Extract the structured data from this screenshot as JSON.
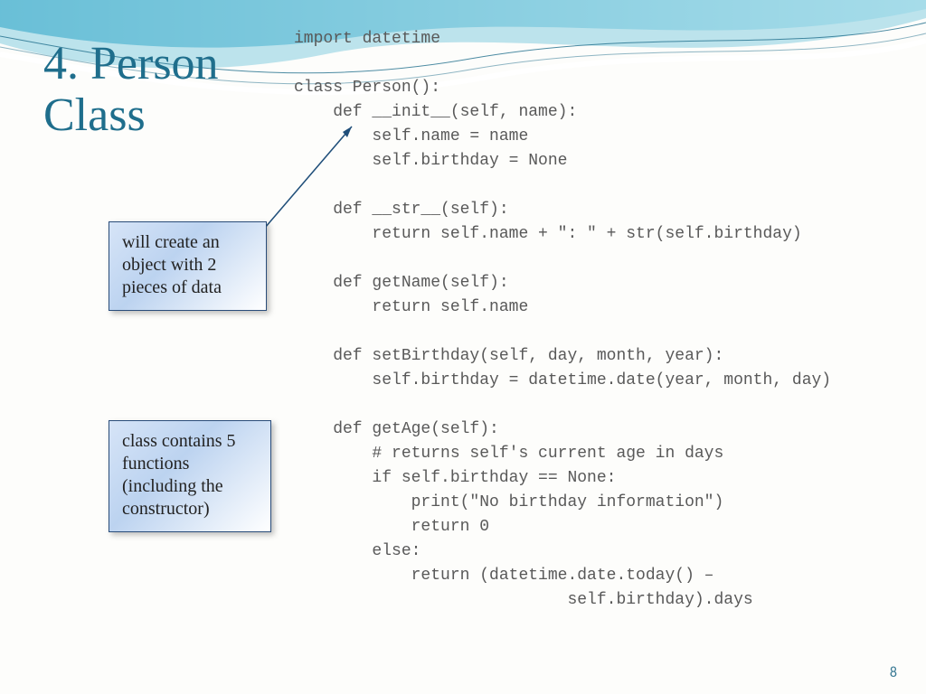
{
  "title_line1": "4. Person",
  "title_line2": "Class",
  "code": "import datetime\n\nclass Person():\n    def __init__(self, name):\n        self.name = name\n        self.birthday = None\n\n    def __str__(self):\n        return self.name + \": \" + str(self.birthday)\n\n    def getName(self):\n        return self.name\n\n    def setBirthday(self, day, month, year):\n        self.birthday = datetime.date(year, month, day)\n\n    def getAge(self):\n        # returns self's current age in days\n        if self.birthday == None:\n            print(\"No birthday information\")\n            return 0\n        else:\n            return (datetime.date.today() –\n                            self.birthday).days",
  "callout1": "will create an object with 2 pieces of data",
  "callout2": "class contains 5 functions (including the constructor)",
  "page_number": "8",
  "colors": {
    "title": "#1F6E8C",
    "code": "#595959",
    "wave_light": "#8ed4e8",
    "wave_dark": "#3aa8c9"
  }
}
